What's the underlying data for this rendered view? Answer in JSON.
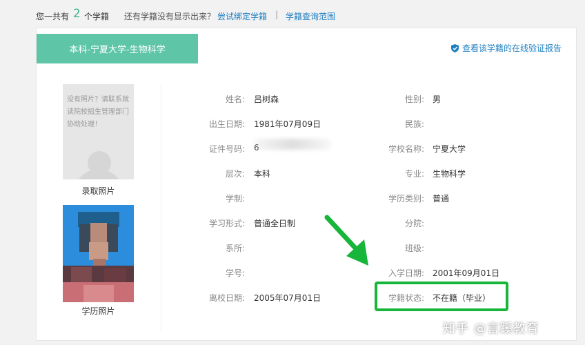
{
  "topbar": {
    "prefix": "您一共有",
    "count": "2",
    "suffix": "个学籍",
    "question": "还有学籍没有显示出来？",
    "bind_link": "尝试绑定学籍",
    "separator": "|",
    "scope_link": "学籍查询范围"
  },
  "card": {
    "tab_title": "本科-宁夏大学-生物科学",
    "verify_link": "查看该学籍的在线验证报告",
    "verify_icon": "shield-check-icon"
  },
  "photos": {
    "admission_placeholder": "没有照片？请联系就读院校招生管理部门协助处理！",
    "admission_label": "录取照片",
    "graduation_label": "学历照片"
  },
  "fields_left": [
    {
      "label": "姓名:",
      "value": "吕树森"
    },
    {
      "label": "出生日期:",
      "value": "1981年07月09日"
    },
    {
      "label": "证件号码:",
      "value": "6"
    },
    {
      "label": "层次:",
      "value": "本科"
    },
    {
      "label": "学制:",
      "value": ""
    },
    {
      "label": "学习形式:",
      "value": "普通全日制"
    },
    {
      "label": "系所:",
      "value": ""
    },
    {
      "label": "学号:",
      "value": ""
    },
    {
      "label": "离校日期:",
      "value": "2005年07月01日"
    }
  ],
  "fields_right": [
    {
      "label": "性别:",
      "value": "男"
    },
    {
      "label": "民族:",
      "value": ""
    },
    {
      "label": "学校名称:",
      "value": "宁夏大学"
    },
    {
      "label": "专业:",
      "value": "生物科学"
    },
    {
      "label": "学历类别:",
      "value": "普通"
    },
    {
      "label": "分院:",
      "value": ""
    },
    {
      "label": "班级:",
      "value": ""
    },
    {
      "label": "入学日期:",
      "value": "2001年09月01日"
    },
    {
      "label": "学籍状态:",
      "value": "不在籍（毕业）"
    }
  ],
  "watermark": "知乎 @言蹊教育",
  "colors": {
    "accent": "#5ec6a6",
    "link": "#1e7fc2",
    "highlight": "#17b539"
  }
}
